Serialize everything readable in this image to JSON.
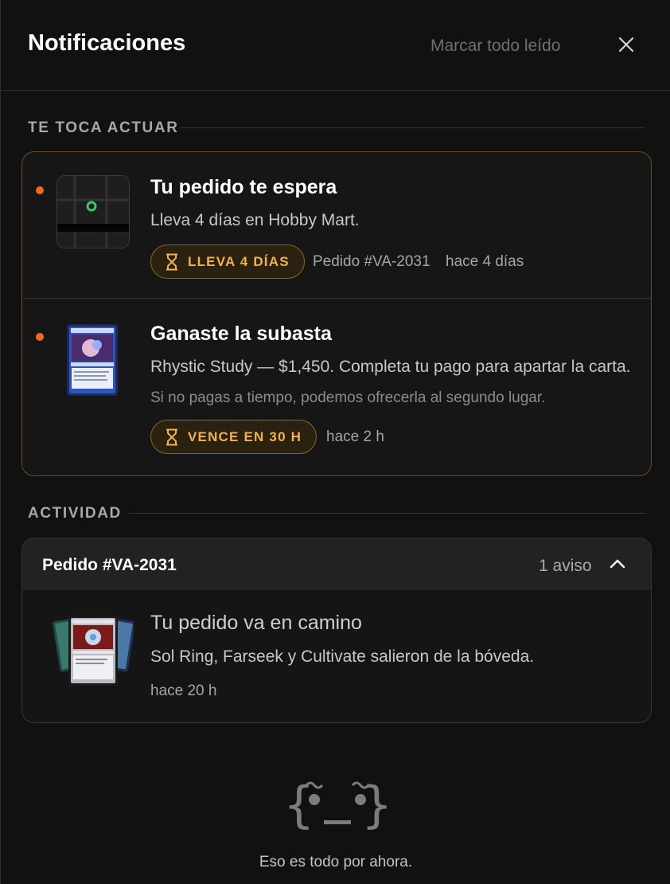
{
  "header": {
    "title": "Notificaciones",
    "mark_all_read": "Marcar todo leído",
    "close_icon": "close-icon"
  },
  "sections": {
    "urgent_label": "TE TOCA ACTUAR",
    "activity_label": "ACTIVIDAD"
  },
  "urgent": [
    {
      "title": "Tu pedido te espera",
      "body": "Lleva 4 días en Hobby Mart.",
      "pill": "LLEVA 4 DÍAS",
      "order": "Pedido #VA-2031",
      "time": "hace 4 días",
      "unread": true,
      "thumb": "map-icon"
    },
    {
      "title": "Ganaste la subasta",
      "body": "Rhystic Study — $1,450. Completa tu pago para apartar la carta.",
      "sub": "Si no pagas a tiempo, podemos ofrecerla al segundo lugar.",
      "pill": "VENCE EN 30 H",
      "time": "hace 2 h",
      "unread": true,
      "thumb": "card-image",
      "card_name": "Rhystic Study"
    }
  ],
  "activity": {
    "group_title": "Pedido #VA-2031",
    "count": "1 aviso",
    "items": [
      {
        "title": "Tu pedido va en camino",
        "body": "Sol Ring, Farseek y Cultivate salieron de la bóveda.",
        "time": "hace 20 h",
        "card_name": "Sol Ring"
      }
    ]
  },
  "empty": {
    "text": "Eso es todo por ahora."
  },
  "colors": {
    "accent": "#f26b1d",
    "pill_text": "#f0b44a",
    "pill_border": "#8a6420",
    "urgent_border": "#6d4d1d",
    "map_pin": "#3ec46d"
  }
}
